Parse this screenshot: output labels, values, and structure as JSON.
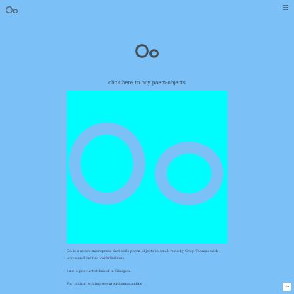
{
  "header": {
    "logo": {
      "icon": "oo-logo-icon"
    },
    "menu": {
      "icon": "hamburger-menu-icon"
    }
  },
  "hero": {
    "logo": {
      "icon": "oo-large-logo-icon"
    }
  },
  "buy_link": {
    "label": "click here to buy poem-objects"
  },
  "feature_image": {
    "icon": "oo-poem-object-image",
    "background": "#00fdfd",
    "shape_color": "#7cc0f8"
  },
  "intro": {
    "p1_name": "Oo",
    "p1_text": " is a micro-micropress that sells poem-objects in small runs by Greg Thomas with occasional invited contributions.",
    "p2": "I am a poet-artist based in Glasgow.",
    "p3_prefix": "For critical writing see ",
    "p3_link": "gregthomas.online"
  },
  "corner_button": {
    "label": "···",
    "icon": "more-dots-icon"
  },
  "colors": {
    "page_background": "#7cc0f8",
    "text": "#374454",
    "logo_stroke": "#434d57"
  }
}
